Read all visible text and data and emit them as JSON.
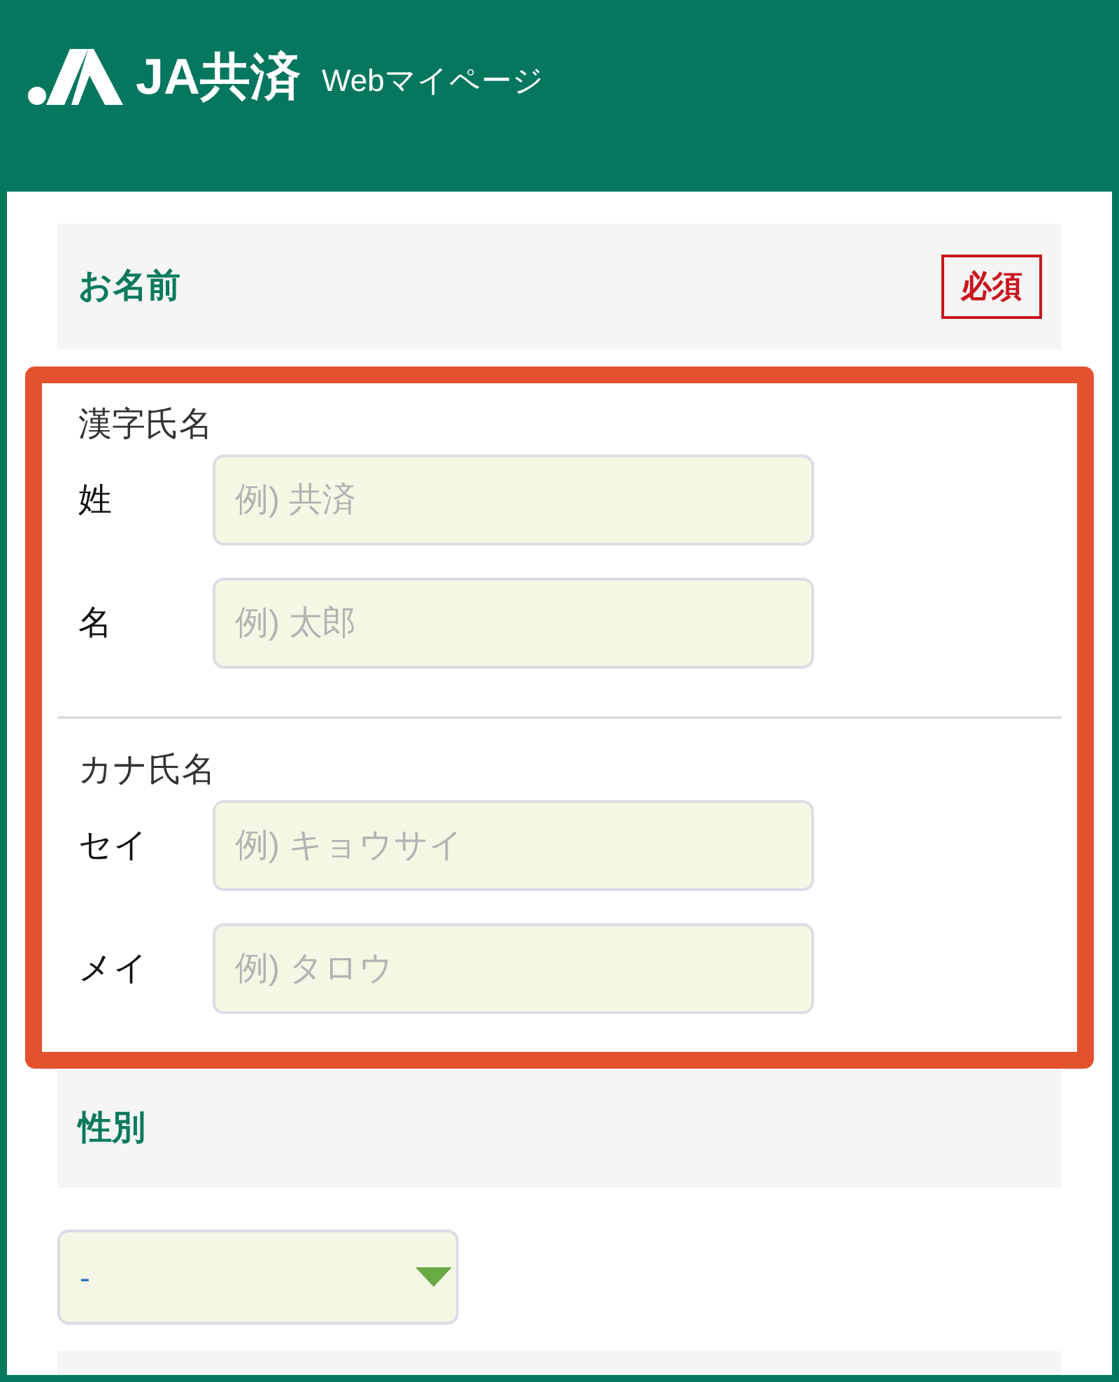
{
  "header": {
    "brand": "JA共済",
    "subtitle": "Webマイページ"
  },
  "sections": [
    {
      "kind": "name",
      "title": "お名前",
      "badge": "必須",
      "highlighted": true,
      "groups": [
        {
          "label": "漢字氏名",
          "fields": [
            {
              "label": "姓",
              "placeholder": "例) 共済"
            },
            {
              "label": "名",
              "placeholder": "例) 太郎"
            }
          ]
        },
        {
          "label": "カナ氏名",
          "fields": [
            {
              "label": "セイ",
              "placeholder": "例) キョウサイ"
            },
            {
              "label": "メイ",
              "placeholder": "例) タロウ"
            }
          ]
        }
      ]
    },
    {
      "kind": "select",
      "title": "性別",
      "select": {
        "value": "-"
      }
    }
  ]
}
